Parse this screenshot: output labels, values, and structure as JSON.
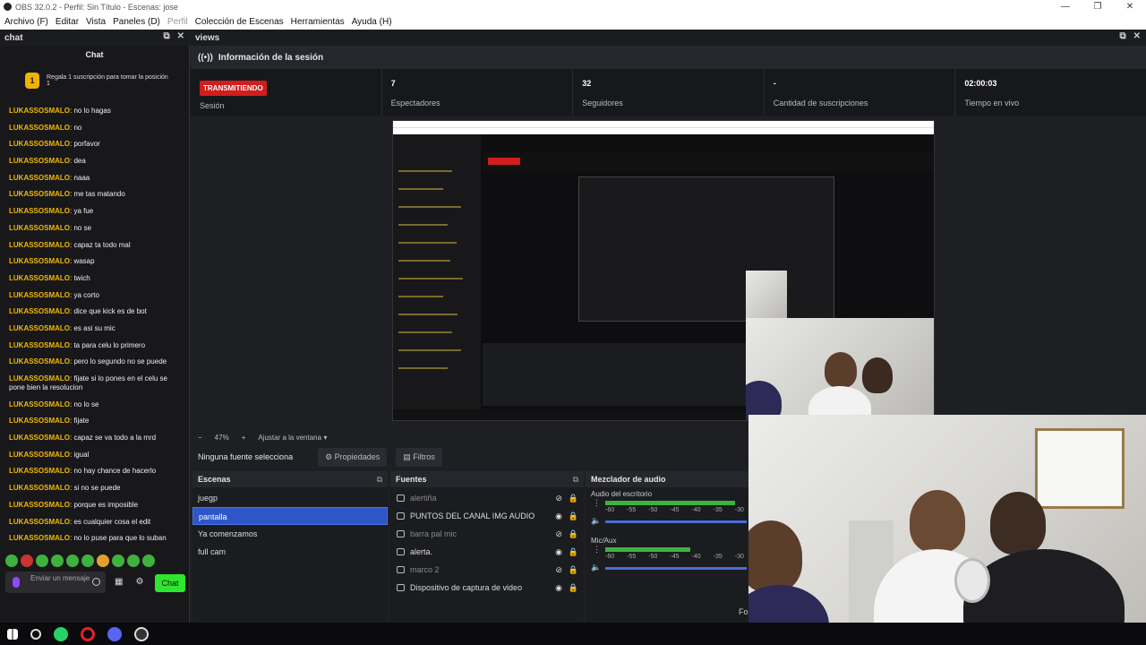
{
  "window": {
    "title": "OBS 32.0.2 - Perfil: Sin Título - Escenas: jose",
    "controls": [
      "—",
      "❐",
      "✕"
    ]
  },
  "menu": [
    "Archivo (F)",
    "Editar",
    "Vista",
    "Paneles (D)",
    "Perfil",
    "Colección de Escenas",
    "Herramientas",
    "Ayuda (H)"
  ],
  "chat_dock": {
    "header": "chat",
    "title": "Chat",
    "gift_badge": "1",
    "gift_text": "Regala 1 suscripción para tomar la posición 1",
    "messages": [
      {
        "user": "LUKASSOSMALO",
        "text": "no lo hagas"
      },
      {
        "user": "LUKASSOSMALO",
        "text": "no"
      },
      {
        "user": "LUKASSOSMALO",
        "text": "porfavor"
      },
      {
        "user": "LUKASSOSMALO",
        "text": "dea"
      },
      {
        "user": "LUKASSOSMALO",
        "text": "naaa"
      },
      {
        "user": "LUKASSOSMALO",
        "text": "me tas matando"
      },
      {
        "user": "LUKASSOSMALO",
        "text": "ya fue"
      },
      {
        "user": "LUKASSOSMALO",
        "text": "no se"
      },
      {
        "user": "LUKASSOSMALO",
        "text": "capaz ta todo mal"
      },
      {
        "user": "LUKASSOSMALO",
        "text": "wasap"
      },
      {
        "user": "LUKASSOSMALO",
        "text": "twich"
      },
      {
        "user": "LUKASSOSMALO",
        "text": "ya corto"
      },
      {
        "user": "LUKASSOSMALO",
        "text": "dice que kick es de bot"
      },
      {
        "user": "LUKASSOSMALO",
        "text": "es asi su mic"
      },
      {
        "user": "LUKASSOSMALO",
        "text": "ta para celu lo primero"
      },
      {
        "user": "LUKASSOSMALO",
        "text": "pero lo segundo no se puede"
      },
      {
        "user": "LUKASSOSMALO",
        "text": "fijate si lo pones en el celu se pone bien la resolucion"
      },
      {
        "user": "LUKASSOSMALO",
        "text": "no lo se"
      },
      {
        "user": "LUKASSOSMALO",
        "text": "fijate"
      },
      {
        "user": "LUKASSOSMALO",
        "text": "capaz se va todo a la mrd"
      },
      {
        "user": "LUKASSOSMALO",
        "text": "igual"
      },
      {
        "user": "LUKASSOSMALO",
        "text": "no hay chance de hacerlo"
      },
      {
        "user": "LUKASSOSMALO",
        "text": "si no se puede"
      },
      {
        "user": "LUKASSOSMALO",
        "text": "porque es imposible"
      },
      {
        "user": "LUKASSOSMALO",
        "text": "es cualquier cosa el edit"
      },
      {
        "user": "LUKASSOSMALO",
        "text": "no lo puse para que lo suban"
      }
    ],
    "input_placeholder": "Enviar un mensaje",
    "send_label": "Chat"
  },
  "views_dock": {
    "header": "views",
    "section_title": "Información de la sesión",
    "stats": [
      {
        "value": "TRANSMITIENDO",
        "label": "Sesión"
      },
      {
        "value": "7",
        "label": "Espectadores"
      },
      {
        "value": "32",
        "label": "Seguidores"
      },
      {
        "value": "-",
        "label": "Cantidad de suscripciones"
      },
      {
        "value": "02:00:03",
        "label": "Tiempo en vivo"
      }
    ]
  },
  "zoom": {
    "minus": "−",
    "level": "47%",
    "plus": "+",
    "fit": "Ajustar a la ventana"
  },
  "source_bar": {
    "status": "Ninguna fuente selecciona",
    "props": "Propiedades",
    "filters": "Filtros"
  },
  "scenes": {
    "title": "Escenas",
    "items": [
      "juegp",
      "pantalla",
      "Ya comenzamos",
      "full cam"
    ],
    "selected": 1
  },
  "sources": {
    "title": "Fuentes",
    "items": [
      {
        "name": "alertiña",
        "dim": true
      },
      {
        "name": "PUNTOS DEL CANAL IMG AUDIO",
        "dim": false
      },
      {
        "name": "barra pal mic",
        "dim": true
      },
      {
        "name": "alerta.",
        "dim": false
      },
      {
        "name": "marco 2",
        "dim": true
      },
      {
        "name": "Dispositivo de captura de video",
        "dim": false
      }
    ]
  },
  "mixer": {
    "title": "Mezclador de audio",
    "tracks": [
      {
        "name": "Audio del escritorio",
        "level": 0.92
      },
      {
        "name": "Mic/Aux",
        "level": 0.6
      }
    ],
    "scale": [
      "-60",
      "-55",
      "-50",
      "-45",
      "-40",
      "-35",
      "-30"
    ]
  },
  "bottom_truncated": "Fo"
}
